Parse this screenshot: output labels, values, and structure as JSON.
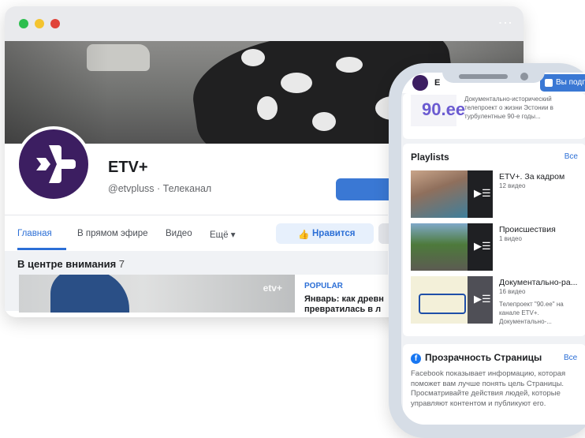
{
  "desktop": {
    "page": {
      "name": "ETV+",
      "handle": "@etvpluss · Телеканал"
    },
    "tabs": [
      {
        "label": "Главная",
        "active": true
      },
      {
        "label": "В прямом эфире"
      },
      {
        "label": "Видео"
      },
      {
        "label": "Ещё ▾"
      }
    ],
    "like_label": "Нравится",
    "featured": {
      "title": "В центре внимания",
      "count": "7",
      "watermark": "etv+",
      "post_tag": "POPULAR",
      "post_title": "Январь: как древн превратилась в л"
    }
  },
  "phone": {
    "header": {
      "name": "E",
      "subscribe_label": "Вы подп"
    },
    "top_card_text": "Документально-исторический телепроект о жизни Эстонии в турбулентные 90-е годы...",
    "top_card_thumb": "90.ee",
    "playlists": {
      "title": "Playlists",
      "link": "Все",
      "items": [
        {
          "title": "ETV+. За кадром",
          "count": "12 видео"
        },
        {
          "title": "Происшествия",
          "count": "1 видео"
        },
        {
          "title": "Документально-ра...",
          "count": "16 видео",
          "desc": "Телепроект \"90.ee\" на канале ETV+. Документально-..."
        }
      ]
    },
    "transparency": {
      "title": "Прозрачность Страницы",
      "link": "Все",
      "body": "Facebook показывает информацию, которая поможет вам лучше понять цель Страницы. Просматривайте действия людей, которые управляют контентом и публикуют его."
    }
  },
  "colors": {
    "brand_purple": "#3c1e61",
    "facebook_blue": "#2c6fd6"
  }
}
